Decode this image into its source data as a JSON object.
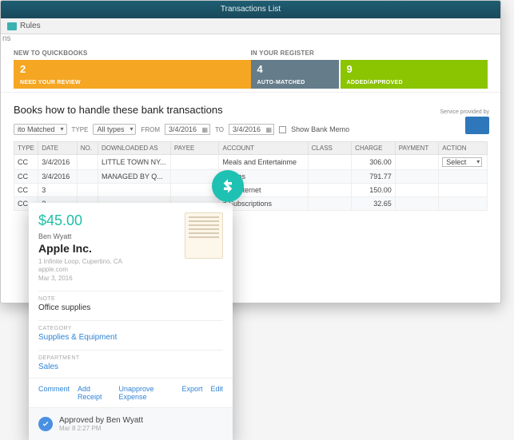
{
  "window": {
    "title": "Transactions List",
    "rules_label": "Rules"
  },
  "status": {
    "new_label": "NEW TO QUICKBOOKS",
    "reg_label": "IN YOUR REGISTER",
    "review": {
      "count": "2",
      "label": "NEED YOUR REVIEW"
    },
    "auto": {
      "count": "4",
      "label": "AUTO-MATCHED"
    },
    "added": {
      "count": "9",
      "label": "ADDED/APPROVED"
    }
  },
  "instruction": "Books how to handle these bank transactions",
  "service_label": "Service provided by",
  "filters": {
    "status_value": "ito Matched",
    "type_label": "TYPE",
    "type_value": "All types",
    "from_label": "FROM",
    "from_value": "3/4/2016",
    "to_label": "TO",
    "to_value": "3/4/2016",
    "memo_label": "Show Bank Memo"
  },
  "columns": {
    "type": "TYPE",
    "date": "DATE",
    "no": "NO.",
    "downloaded": "DOWNLOADED AS",
    "payee": "PAYEE",
    "account": "ACCOUNT",
    "class": "CLASS",
    "charge": "CHARGE",
    "payment": "PAYMENT",
    "action": "ACTION"
  },
  "rows": [
    {
      "type": "CC",
      "date": "3/4/2016",
      "no": "",
      "downloaded": "LITTLE TOWN NY...",
      "payee": "",
      "account": "Meals and Entertainme",
      "class": "",
      "charge": "306.00",
      "payment": "",
      "action": "Select"
    },
    {
      "type": "CC",
      "date": "3/4/2016",
      "no": "",
      "downloaded": "MANAGED BY Q...",
      "payee": "",
      "account": "upplies",
      "class": "",
      "charge": "791.77",
      "payment": "",
      "action": ""
    },
    {
      "type": "CC",
      "date": "3",
      "no": "",
      "downloaded": "",
      "payee": "",
      "account": "and Internet",
      "class": "",
      "charge": "150.00",
      "payment": "",
      "action": ""
    },
    {
      "type": "CC",
      "date": "3",
      "no": "",
      "downloaded": "",
      "payee": "",
      "account": "d Subscriptions",
      "class": "",
      "charge": "32.65",
      "payment": "",
      "action": ""
    }
  ],
  "card": {
    "amount": "$45.00",
    "person": "Ben Wyatt",
    "merchant": "Apple Inc.",
    "address1": "1 Infinite Loop, Cupertino, CA",
    "address2": "apple.com",
    "address3": "Mar 3, 2016",
    "note_label": "NOTE",
    "note_value": "Office supplies",
    "cat_label": "CATEGORY",
    "cat_value": "Supplies & Equipment",
    "dept_label": "DEPARTMENT",
    "dept_value": "Sales",
    "links": {
      "comment": "Comment",
      "receipt": "Add Receipt",
      "unapprove": "Unapprove Expense",
      "export": "Export",
      "edit": "Edit"
    },
    "approved_text": "Approved by Ben Wyatt",
    "approved_time": "Mar 8 2:27 PM"
  }
}
